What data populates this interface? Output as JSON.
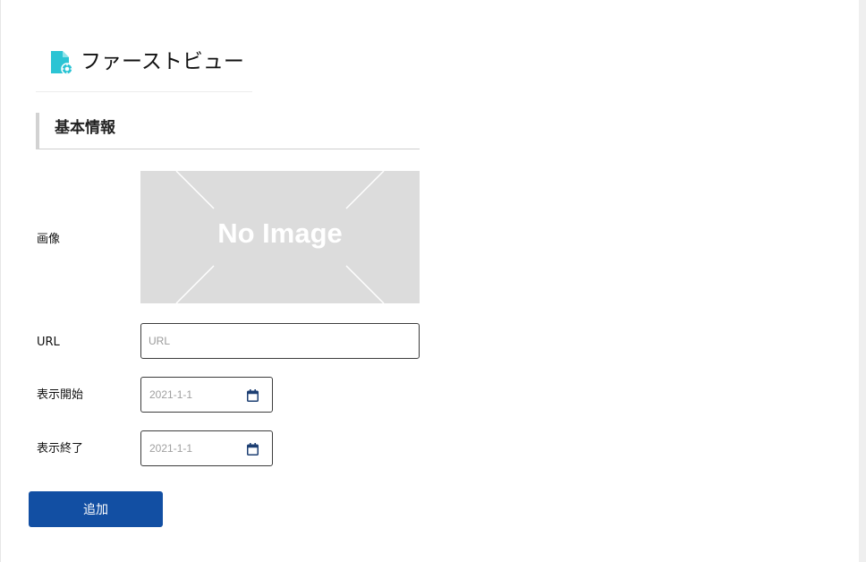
{
  "header": {
    "title": "ファーストビュー",
    "icon": "document-gear-icon",
    "icon_color": "#2bc4d4"
  },
  "section": {
    "title": "基本情報"
  },
  "form": {
    "image": {
      "label": "画像",
      "placeholder_text": "No Image"
    },
    "url": {
      "label": "URL",
      "placeholder": "URL"
    },
    "display_start": {
      "label": "表示開始",
      "value": "2021-1-1",
      "icon": "calendar-icon"
    },
    "display_end": {
      "label": "表示終了",
      "value": "2021-1-1",
      "icon": "calendar-icon"
    }
  },
  "actions": {
    "add_label": "追加",
    "add_color": "#124fa3"
  }
}
